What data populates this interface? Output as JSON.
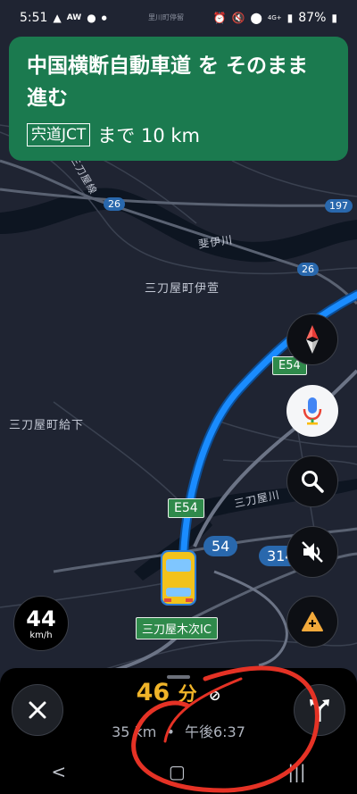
{
  "status_bar": {
    "time": "5:51",
    "town_label": "里川町停留",
    "left_icons": [
      "navigation-icon",
      "aw-icon",
      "line-icon",
      "dot-icon"
    ],
    "right_icons": [
      "alarm-icon",
      "mute-icon",
      "location-icon",
      "lte-icon",
      "signal-icon",
      "battery-icon"
    ],
    "network": "4G+",
    "battery": "87%"
  },
  "nav_banner": {
    "instruction": "中国横断自動車道 を そのまま進む",
    "junction": "宍道JCT",
    "distance": "まで 10 km",
    "color": "#1b7a4f"
  },
  "map": {
    "place_labels": {
      "imaru": "三刀屋町伊萱",
      "kyuge": "三刀屋町給下",
      "river_hii": "斐伊川",
      "river_mitoya": "三刀屋川",
      "line": "三刀屋線",
      "ic": "三刀屋木次IC"
    },
    "shields": {
      "r26a": "26",
      "r26b": "26",
      "r197": "197",
      "e54a": "E54",
      "e54b": "E54",
      "r54": "54",
      "r314": "314"
    },
    "route_color": "#1a8cff"
  },
  "side_buttons": [
    "compass-icon",
    "microphone-icon",
    "search-icon",
    "mute-icon",
    "report-incident-icon"
  ],
  "speed": {
    "value": "44",
    "unit": "km/h"
  },
  "bottom": {
    "eta_value": "46",
    "eta_unit": "分",
    "distance": "35 km",
    "separator": "•",
    "arrival": "午後6:37",
    "nav_icons": [
      "back-icon",
      "home-icon",
      "recents-icon"
    ],
    "eta_color": "#f0b429"
  }
}
